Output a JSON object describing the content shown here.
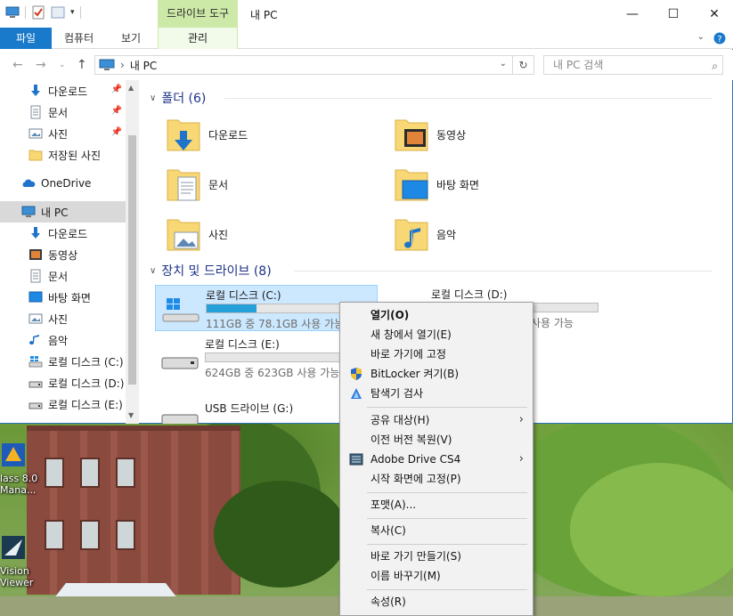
{
  "window": {
    "title": "내 PC",
    "context_tab_title": "드라이브 도구",
    "min": "—",
    "max": "☐",
    "close": "✕"
  },
  "ribbon": {
    "file_tab": "파일",
    "tabs": [
      "컴퓨터",
      "보기"
    ],
    "manage_tab": "관리"
  },
  "address": {
    "path_separator": "›",
    "path": "내 PC",
    "search_placeholder": "내 PC 검색"
  },
  "nav": {
    "items": [
      {
        "label": "다운로드",
        "icon": "download-arrow-icon",
        "pinned": true
      },
      {
        "label": "문서",
        "icon": "document-icon",
        "pinned": true
      },
      {
        "label": "사진",
        "icon": "picture-icon",
        "pinned": true
      },
      {
        "label": "저장된 사진",
        "icon": "folder-icon",
        "pinned": false
      },
      {
        "label": "OneDrive",
        "icon": "onedrive-cloud-icon",
        "pinned": false
      },
      {
        "label": "내 PC",
        "icon": "computer-icon",
        "pinned": false,
        "selected": true
      },
      {
        "label": "다운로드",
        "icon": "download-arrow-icon"
      },
      {
        "label": "동영상",
        "icon": "video-icon"
      },
      {
        "label": "문서",
        "icon": "document-icon"
      },
      {
        "label": "바탕 화면",
        "icon": "desktop-icon"
      },
      {
        "label": "사진",
        "icon": "picture-icon"
      },
      {
        "label": "음악",
        "icon": "music-note-icon"
      },
      {
        "label": "로컬 디스크 (C:)",
        "icon": "windows-drive-icon"
      },
      {
        "label": "로컬 디스크 (D:)",
        "icon": "drive-icon"
      },
      {
        "label": "로컬 디스크 (E:)",
        "icon": "drive-icon"
      }
    ]
  },
  "content": {
    "folders_header": "폴더 (6)",
    "folders": [
      {
        "label": "다운로드",
        "icon": "download-folder-icon"
      },
      {
        "label": "동영상",
        "icon": "video-folder-icon"
      },
      {
        "label": "문서",
        "icon": "document-folder-icon"
      },
      {
        "label": "바탕 화면",
        "icon": "desktop-folder-icon"
      },
      {
        "label": "사진",
        "icon": "picture-folder-icon"
      },
      {
        "label": "음악",
        "icon": "music-folder-icon"
      }
    ],
    "drives_header": "장치 및 드라이브 (8)",
    "drives": [
      {
        "name": "로컬 디스크 (C:)",
        "info": "111GB 중 78.1GB 사용 가능",
        "used_fraction": 0.3,
        "selected": true
      },
      {
        "name": "로컬 디스크 (D:)",
        "info": "사용 가능",
        "used_fraction": 0.0
      },
      {
        "name": "로컬 디스크 (E:)",
        "info": "624GB 중 623GB 사용 가능",
        "used_fraction": 0.0
      },
      {
        "name": "USB 드라이브 (G:)",
        "info": ""
      }
    ]
  },
  "context_menu": {
    "items": [
      {
        "label": "열기(O)",
        "bold": true
      },
      {
        "label": "새 창에서 열기(E)"
      },
      {
        "label": "바로 가기에 고정"
      },
      {
        "label": "BitLocker 켜기(B)",
        "icon": "shield-icon"
      },
      {
        "label": "탐색기 검사",
        "icon": "scan-icon"
      },
      {
        "label": "공유 대상(H)",
        "submenu": true
      },
      {
        "label": "이전 버전 복원(V)"
      },
      {
        "label": "Adobe Drive CS4",
        "icon": "adobe-drive-icon",
        "submenu": true
      },
      {
        "label": "시작 화면에 고정(P)"
      },
      {
        "label": "포맷(A)..."
      },
      {
        "label": "복사(C)"
      },
      {
        "label": "바로 가기 만들기(S)"
      },
      {
        "label": "이름 바꾸기(M)"
      },
      {
        "label": "속성(R)"
      }
    ],
    "submenu_arrow": "›"
  },
  "desktop": {
    "icons": [
      {
        "label": "lass 8.0\nMana..."
      },
      {
        "label": "Vision\nViewer"
      }
    ]
  },
  "colors": {
    "accent": "#1979ca",
    "selection": "#cce8ff",
    "drive_bar": "#26a0da",
    "header_text": "#1e3287"
  }
}
